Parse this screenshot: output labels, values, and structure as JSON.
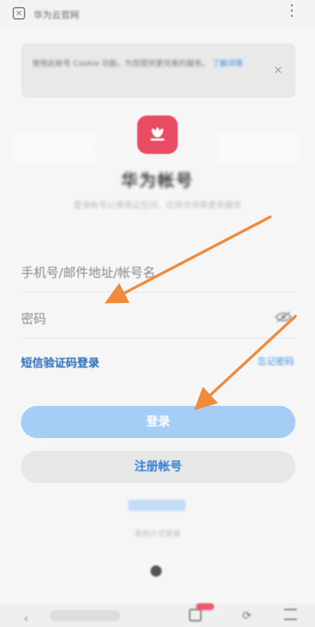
{
  "header": {
    "title": "华为云官网",
    "close_glyph": "✕",
    "more_glyph": "⋮"
  },
  "notice": {
    "text": "使用此帐号 Cookie 功能，为您提供更完善的服务。",
    "link": "了解详情",
    "close_glyph": "×"
  },
  "brand": {
    "title": "华为帐号",
    "subtitle": "登录帐号以使用云空间、应用市场等更多服务",
    "logo_color": "#e84c62"
  },
  "form": {
    "account_placeholder": "手机号/邮件地址/帐号名",
    "password_placeholder": "密码",
    "sms_login": "短信验证码登录",
    "forgot_password": "忘记密码"
  },
  "buttons": {
    "login": "登录",
    "register": "注册帐号"
  },
  "other": {
    "link": "其他方式登录",
    "text": "其他方式登录"
  },
  "colors": {
    "accent": "#1f66b8",
    "login_button": "#a6cdf5",
    "arrow": "#f08a3c"
  }
}
